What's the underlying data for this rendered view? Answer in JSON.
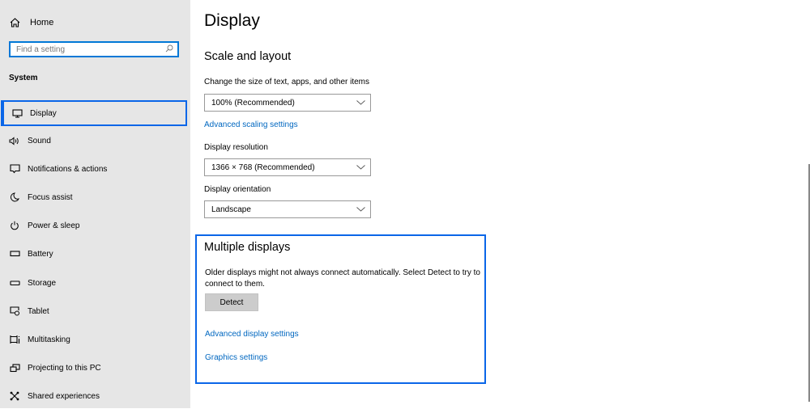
{
  "sidebar": {
    "home_label": "Home",
    "search_placeholder": "Find a setting",
    "section_title": "System",
    "items": [
      {
        "label": "Display",
        "icon": "monitor-icon",
        "selected": true
      },
      {
        "label": "Sound",
        "icon": "speaker-icon"
      },
      {
        "label": "Notifications & actions",
        "icon": "notification-icon"
      },
      {
        "label": "Focus assist",
        "icon": "moon-icon"
      },
      {
        "label": "Power & sleep",
        "icon": "power-icon"
      },
      {
        "label": "Battery",
        "icon": "battery-icon"
      },
      {
        "label": "Storage",
        "icon": "storage-icon"
      },
      {
        "label": "Tablet",
        "icon": "tablet-icon"
      },
      {
        "label": "Multitasking",
        "icon": "multitasking-icon"
      },
      {
        "label": "Projecting to this PC",
        "icon": "projecting-icon"
      },
      {
        "label": "Shared experiences",
        "icon": "shared-experiences-icon"
      }
    ]
  },
  "main": {
    "title": "Display",
    "scale_section": {
      "title": "Scale and layout",
      "size_label": "Change the size of text, apps, and other items",
      "size_value": "100% (Recommended)",
      "advanced_scaling_link": "Advanced scaling settings",
      "resolution_label": "Display resolution",
      "resolution_value": "1366 × 768 (Recommended)",
      "orientation_label": "Display orientation",
      "orientation_value": "Landscape"
    },
    "multiple_displays": {
      "title": "Multiple displays",
      "description": "Older displays might not always connect automatically. Select Detect to try to connect to them.",
      "detect_button": "Detect",
      "advanced_display_link": "Advanced display settings",
      "graphics_link": "Graphics settings"
    }
  },
  "colors": {
    "accent": "#0a66e8",
    "link": "#0067c0",
    "sidebar_bg": "#e6e6e6"
  }
}
